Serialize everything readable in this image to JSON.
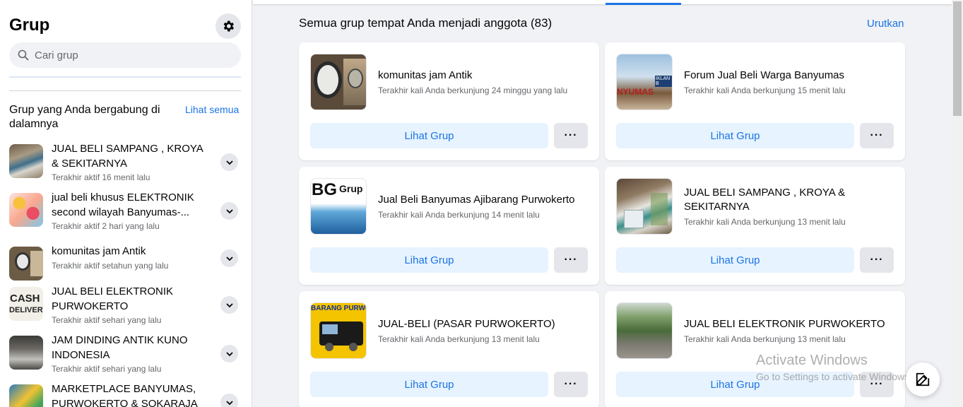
{
  "sidebar": {
    "title": "Grup",
    "search_placeholder": "Cari grup",
    "section_title": "Grup yang Anda bergabung di dalamnya",
    "see_all": "Lihat semua",
    "items": [
      {
        "name": "JUAL BELI SAMPANG , KROYA & SEKITARNYA",
        "sub": "Terakhir aktif 16 menit lalu"
      },
      {
        "name": "jual beli khusus ELEKTRONIK second wilayah Banyumas-...",
        "sub": "Terakhir aktif 2 hari yang lalu"
      },
      {
        "name": "komunitas jam Antik",
        "sub": "Terakhir aktif setahun yang lalu"
      },
      {
        "name": "JUAL BELI ELEKTRONIK PURWOKERTO",
        "sub": "Terakhir aktif sehari yang lalu"
      },
      {
        "name": "JAM DINDING ANTIK KUNO INDONESIA",
        "sub": "Terakhir aktif sehari yang lalu"
      },
      {
        "name": "MARKETPLACE BANYUMAS, PURWOKERTO & SOKARAJA",
        "sub": ""
      }
    ]
  },
  "main": {
    "title": "Semua grup tempat Anda menjadi anggota (83)",
    "sort_label": "Urutkan",
    "view_label": "Lihat Grup",
    "more_label": "···",
    "cards": [
      {
        "name": "komunitas jam Antik",
        "sub": "Terakhir kali Anda berkunjung 24 minggu yang lalu"
      },
      {
        "name": "Forum Jual Beli Warga Banyumas",
        "sub": "Terakhir kali Anda berkunjung 15 menit lalu"
      },
      {
        "name": "Jual Beli Banyumas Ajibarang Purwokerto",
        "sub": "Terakhir kali Anda berkunjung 14 menit lalu"
      },
      {
        "name": "JUAL BELI SAMPANG , KROYA & SEKITARNYA",
        "sub": "Terakhir kali Anda berkunjung 13 menit lalu"
      },
      {
        "name": "JUAL-BELI (PASAR PURWOKERTO)",
        "sub": "Terakhir kali Anda berkunjung 13 menit lalu"
      },
      {
        "name": "JUAL BELI ELEKTRONIK PURWOKERTO",
        "sub": "Terakhir kali Anda berkunjung 13 menit lalu"
      }
    ]
  },
  "thumb_text": {
    "cash": "CASH",
    "delivery": "DELIVERY",
    "bg": "BG",
    "grup": "Grup",
    "iklan": "IKLAN B",
    "nyumas": "NYUMAS",
    "barang": "BARANG PURWO"
  },
  "watermark": {
    "line1": "Activate Windows",
    "line2": "Go to Settings to activate Windows."
  },
  "colors": {
    "accent": "#1b74e4",
    "light_accent": "#e7f3ff",
    "bg": "#f0f2f5"
  }
}
